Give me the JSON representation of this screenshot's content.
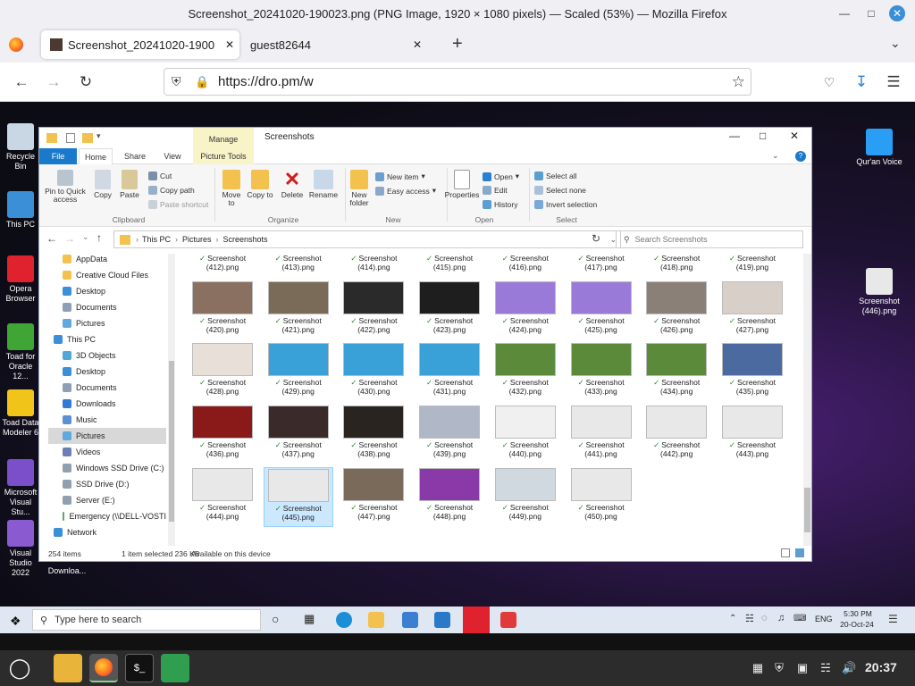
{
  "browser": {
    "window_title": "Screenshot_20241020-190023.png (PNG Image, 1920 × 1080 pixels) — Scaled (53%) — Mozilla Firefox",
    "tabs": [
      {
        "label": "Screenshot_20241020-1900",
        "active": true
      },
      {
        "label": "guest82644",
        "active": false
      }
    ],
    "new_tab_label": "+",
    "url": "https://dro.pm/w"
  },
  "desktop": {
    "left_icons": [
      {
        "label": "Recycle Bin",
        "color": "#c9d6e3"
      },
      {
        "label": "This PC",
        "color": "#3a8fd6"
      },
      {
        "label": "Opera Browser",
        "color": "#e0222f"
      },
      {
        "label": "Toad for Oracle 12...",
        "color": "#3fa535"
      },
      {
        "label": "Toad Data Modeler 6",
        "color": "#f0c419"
      },
      {
        "label": "Microsoft Visual Stu...",
        "color": "#7b4fc9"
      },
      {
        "label": "Visual Studio 2022",
        "color": "#8a5ad0"
      }
    ],
    "bottom_label": "Downloa...",
    "right_icons": [
      {
        "label": "Qur'an Voice",
        "color": "#2a9df4"
      },
      {
        "label": "Screenshot (446).png",
        "color": "#e8e8e8"
      }
    ]
  },
  "explorer": {
    "title": "Screenshots",
    "context_tab": "Manage",
    "ribbon_tabs": [
      "File",
      "Home",
      "Share",
      "View",
      "Picture Tools"
    ],
    "clipboard": {
      "pin": "Pin to Quick access",
      "copy": "Copy",
      "paste": "Paste",
      "cut": "Cut",
      "copy_path": "Copy path",
      "paste_shortcut": "Paste shortcut",
      "group": "Clipboard"
    },
    "organize": {
      "move_to": "Move to",
      "copy_to": "Copy to",
      "delete": "Delete",
      "rename": "Rename",
      "group": "Organize"
    },
    "new": {
      "new_folder": "New folder",
      "new_item": "New item",
      "easy_access": "Easy access",
      "group": "New"
    },
    "open": {
      "properties": "Properties",
      "open": "Open",
      "edit": "Edit",
      "history": "History",
      "group": "Open"
    },
    "select": {
      "select_all": "Select all",
      "select_none": "Select none",
      "invert": "Invert selection",
      "group": "Select"
    },
    "breadcrumb": [
      "This PC",
      "Pictures",
      "Screenshots"
    ],
    "search_placeholder": "Search Screenshots",
    "nav_items": [
      {
        "label": "AppData",
        "color": "#f2c14e",
        "indent": 0
      },
      {
        "label": "Creative Cloud Files",
        "color": "#f2c14e",
        "indent": 0
      },
      {
        "label": "Desktop",
        "color": "#3a8fd6",
        "indent": 0
      },
      {
        "label": "Documents",
        "color": "#8c9fb5",
        "indent": 0
      },
      {
        "label": "Pictures",
        "color": "#5fa8e0",
        "indent": 0
      },
      {
        "label": "This PC",
        "color": "#3a8fd6",
        "indent": -1
      },
      {
        "label": "3D Objects",
        "color": "#4fa8d8",
        "indent": 0
      },
      {
        "label": "Desktop",
        "color": "#3a8fd6",
        "indent": 0
      },
      {
        "label": "Documents",
        "color": "#8c9fb5",
        "indent": 0
      },
      {
        "label": "Downloads",
        "color": "#2f7bd6",
        "indent": 0
      },
      {
        "label": "Music",
        "color": "#5b8fd6",
        "indent": 0
      },
      {
        "label": "Pictures",
        "color": "#5fa8e0",
        "indent": 0,
        "selected": true
      },
      {
        "label": "Videos",
        "color": "#6a7fb5",
        "indent": 0
      },
      {
        "label": "Windows SSD Drive (C:)",
        "color": "#8fa0b0",
        "indent": 0
      },
      {
        "label": "SSD Drive (D:)",
        "color": "#8fa0b0",
        "indent": 0
      },
      {
        "label": "Server (E:)",
        "color": "#8fa0b0",
        "indent": 0
      },
      {
        "label": "Emergency (\\\\DELL-VOSTI",
        "color": "#6a9f6a",
        "indent": 0
      },
      {
        "label": "Network",
        "color": "#3a8fd6",
        "indent": -1
      }
    ],
    "files": [
      {
        "line1": "Screenshot",
        "line2": "(412).png",
        "thumb": "#7a5fc8"
      },
      {
        "line1": "Screenshot",
        "line2": "(413).png",
        "thumb": "#4a3a30"
      },
      {
        "line1": "Screenshot",
        "line2": "(414).png",
        "thumb": "#8b6fd0"
      },
      {
        "line1": "Screenshot",
        "line2": "(415).png",
        "thumb": "#8b6fd0"
      },
      {
        "line1": "Screenshot",
        "line2": "(416).png",
        "thumb": "#222222"
      },
      {
        "line1": "Screenshot",
        "line2": "(417).png",
        "thumb": "#3a3a7a"
      },
      {
        "line1": "Screenshot",
        "line2": "(418).png",
        "thumb": "#5a4a40"
      },
      {
        "line1": "Screenshot",
        "line2": "(419).png",
        "thumb": "#4a3a2a"
      },
      {
        "line1": "Screenshot",
        "line2": "(420).png",
        "thumb": "#8a7060"
      },
      {
        "line1": "Screenshot",
        "line2": "(421).png",
        "thumb": "#7a6a58"
      },
      {
        "line1": "Screenshot",
        "line2": "(422).png",
        "thumb": "#2a2a2a"
      },
      {
        "line1": "Screenshot",
        "line2": "(423).png",
        "thumb": "#1e1e1e"
      },
      {
        "line1": "Screenshot",
        "line2": "(424).png",
        "thumb": "#9a7ad8"
      },
      {
        "line1": "Screenshot",
        "line2": "(425).png",
        "thumb": "#9a7ad8"
      },
      {
        "line1": "Screenshot",
        "line2": "(426).png",
        "thumb": "#8a8078"
      },
      {
        "line1": "Screenshot",
        "line2": "(427).png",
        "thumb": "#d8d0c8"
      },
      {
        "line1": "Screenshot",
        "line2": "(428).png",
        "thumb": "#e8e0d8"
      },
      {
        "line1": "Screenshot",
        "line2": "(429).png",
        "thumb": "#3aa0d8"
      },
      {
        "line1": "Screenshot",
        "line2": "(430).png",
        "thumb": "#3aa0d8"
      },
      {
        "line1": "Screenshot",
        "line2": "(431).png",
        "thumb": "#3aa0d8"
      },
      {
        "line1": "Screenshot",
        "line2": "(432).png",
        "thumb": "#5a8a3a"
      },
      {
        "line1": "Screenshot",
        "line2": "(433).png",
        "thumb": "#5a8a3a"
      },
      {
        "line1": "Screenshot",
        "line2": "(434).png",
        "thumb": "#5a8a3a"
      },
      {
        "line1": "Screenshot",
        "line2": "(435).png",
        "thumb": "#4a6aa0"
      },
      {
        "line1": "Screenshot",
        "line2": "(436).png",
        "thumb": "#8a1a1a"
      },
      {
        "line1": "Screenshot",
        "line2": "(437).png",
        "thumb": "#3a2a2a"
      },
      {
        "line1": "Screenshot",
        "line2": "(438).png",
        "thumb": "#2a2420"
      },
      {
        "line1": "Screenshot",
        "line2": "(439).png",
        "thumb": "#b0b8c8"
      },
      {
        "line1": "Screenshot",
        "line2": "(440).png",
        "thumb": "#f0f0f0"
      },
      {
        "line1": "Screenshot",
        "line2": "(441).png",
        "thumb": "#e8e8e8"
      },
      {
        "line1": "Screenshot",
        "line2": "(442).png",
        "thumb": "#e8e8e8"
      },
      {
        "line1": "Screenshot",
        "line2": "(443).png",
        "thumb": "#e8e8e8"
      },
      {
        "line1": "Screenshot",
        "line2": "(444).png",
        "thumb": "#e8e8e8"
      },
      {
        "line1": "Screenshot",
        "line2": "(445).png",
        "thumb": "#e8e8e8",
        "selected": true
      },
      {
        "line1": "Screenshot",
        "line2": "(447).png",
        "thumb": "#7a6a5a"
      },
      {
        "line1": "Screenshot",
        "line2": "(448).png",
        "thumb": "#8a3aa8"
      },
      {
        "line1": "Screenshot",
        "line2": "(449).png",
        "thumb": "#d0d8e0"
      },
      {
        "line1": "Screenshot",
        "line2": "(450).png",
        "thumb": "#e8e8e8"
      }
    ],
    "status": {
      "count": "254 items",
      "selected": "1 item selected  236 KB",
      "availability": "Available on this device"
    }
  },
  "win_taskbar": {
    "search_placeholder": "Type here to search",
    "lang": "ENG",
    "time": "5:30 PM",
    "date": "20-Oct-24"
  },
  "mint_panel": {
    "clock": "20:37"
  }
}
